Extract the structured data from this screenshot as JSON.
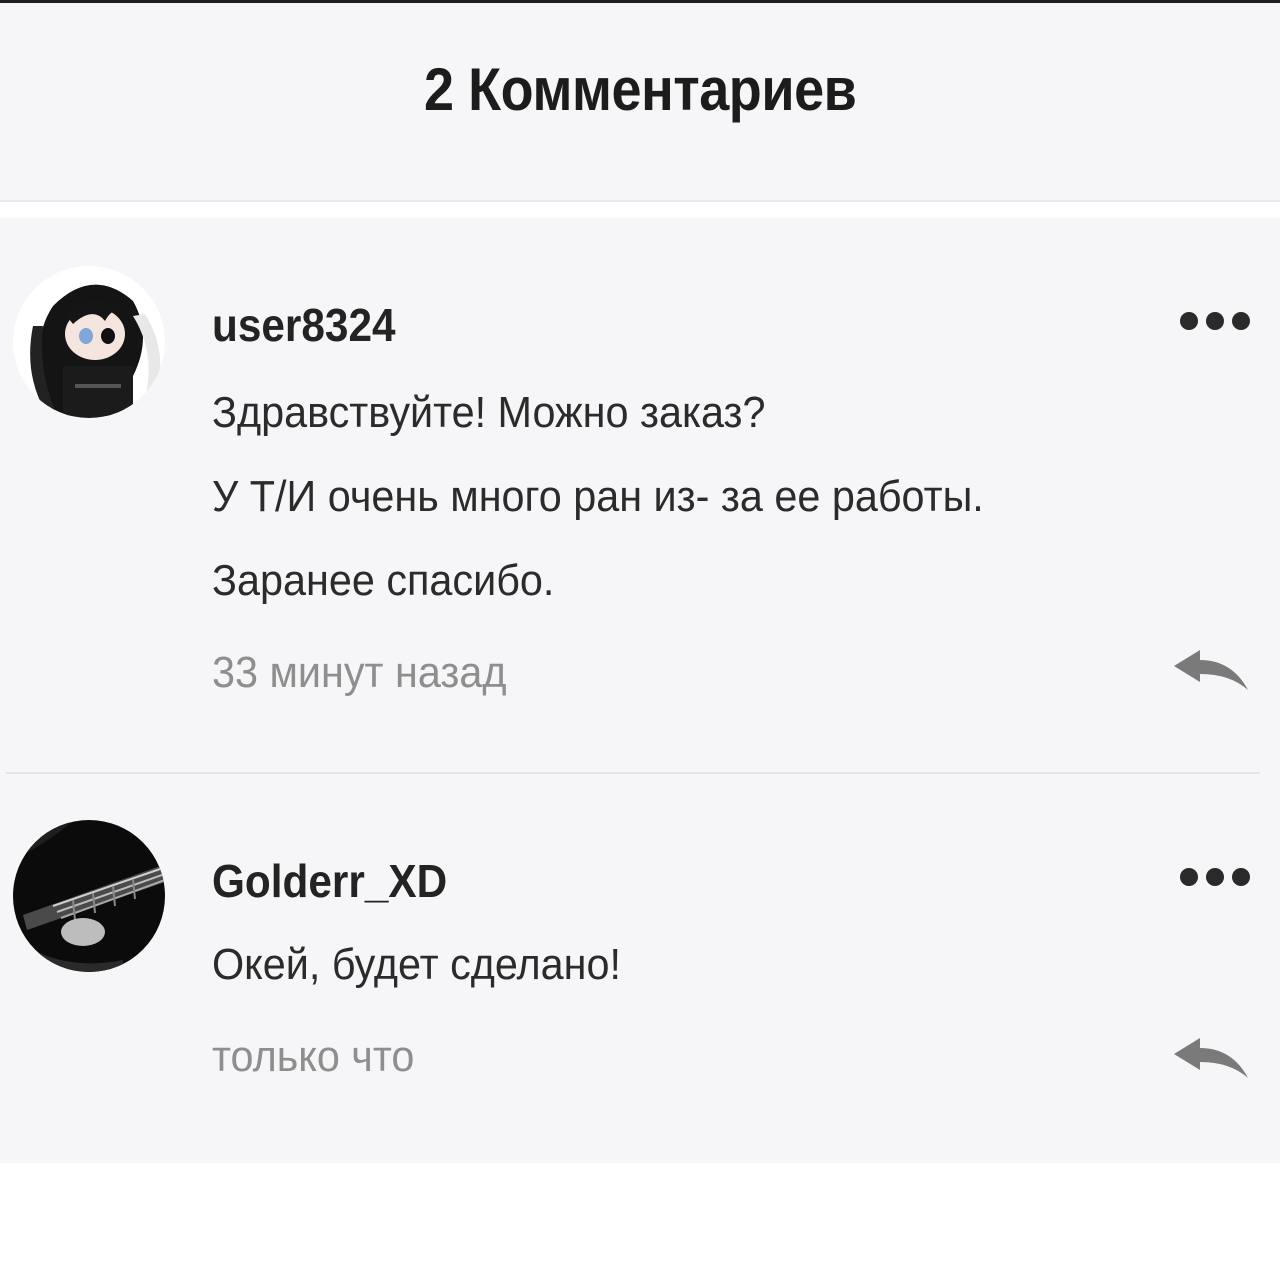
{
  "header": {
    "title": "2 Комментариев"
  },
  "comments": [
    {
      "username": "user8324",
      "avatar": "anime-girl-avatar",
      "lines": [
        "Здравствуйте! Можно заказ?",
        "У Т/И очень много ран из- за ее работы.",
        "Заранее спасибо."
      ],
      "time": "33 минут назад"
    },
    {
      "username": "Golderr_XD",
      "avatar": "guitar-photo-avatar",
      "lines": [
        "Окей, будет сделано!"
      ],
      "time": "только что"
    }
  ],
  "icons": {
    "menu": "more-dots-icon",
    "reply": "reply-arrow-icon"
  },
  "colors": {
    "background": "#f6f5f7",
    "text": "#2b2b2b",
    "meta": "#8e8e8e"
  }
}
